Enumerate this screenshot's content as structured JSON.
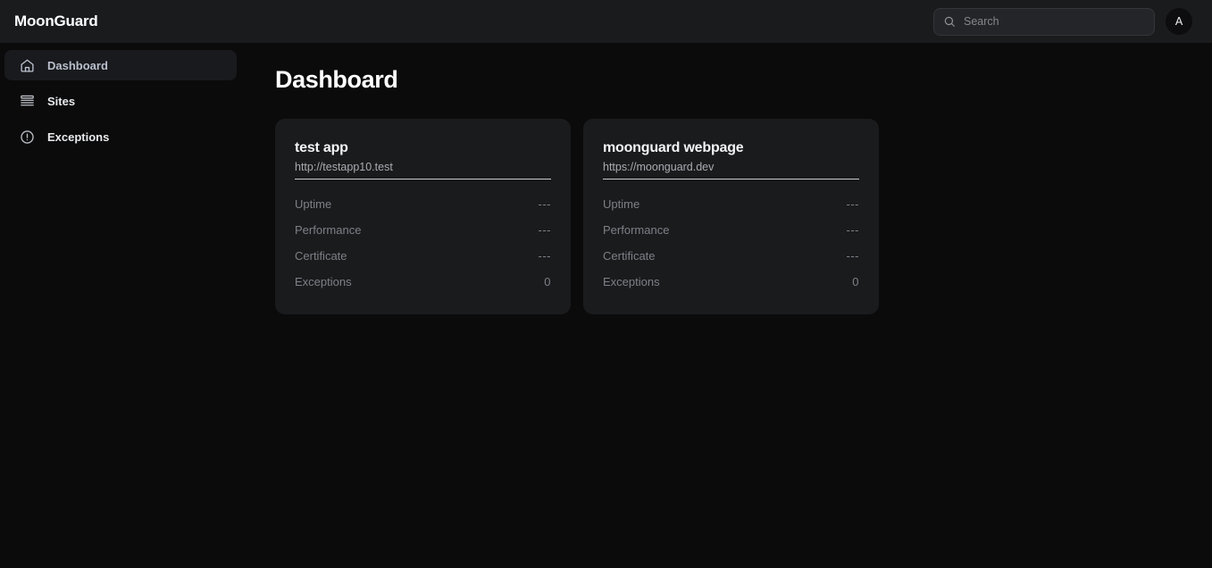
{
  "header": {
    "brand": "MoonGuard",
    "search": {
      "placeholder": "Search",
      "value": "",
      "icon": "search-icon"
    },
    "avatar": {
      "initial": "A"
    }
  },
  "sidebar": {
    "items": [
      {
        "label": "Dashboard",
        "icon": "home-icon",
        "active": true
      },
      {
        "label": "Sites",
        "icon": "stack-icon",
        "active": false
      },
      {
        "label": "Exceptions",
        "icon": "alert-circle-icon",
        "active": false
      }
    ]
  },
  "main": {
    "page_title": "Dashboard",
    "cards": [
      {
        "title": "test app",
        "url": "http://testapp10.test",
        "metrics": [
          {
            "label": "Uptime",
            "value": "---"
          },
          {
            "label": "Performance",
            "value": "---"
          },
          {
            "label": "Certificate",
            "value": "---"
          },
          {
            "label": "Exceptions",
            "value": "0"
          }
        ]
      },
      {
        "title": "moonguard webpage",
        "url": "https://moonguard.dev",
        "metrics": [
          {
            "label": "Uptime",
            "value": "---"
          },
          {
            "label": "Performance",
            "value": "---"
          },
          {
            "label": "Certificate",
            "value": "---"
          },
          {
            "label": "Exceptions",
            "value": "0"
          }
        ]
      }
    ]
  },
  "colors": {
    "page_background": "#0b0b0c",
    "header_background": "#1a1b1d",
    "card_background": "#1a1b1d",
    "active_nav_background": "#191a1d",
    "active_nav_text": "#b9c0cd",
    "muted_text": "#7d8086",
    "primary_text": "#ffffff"
  }
}
